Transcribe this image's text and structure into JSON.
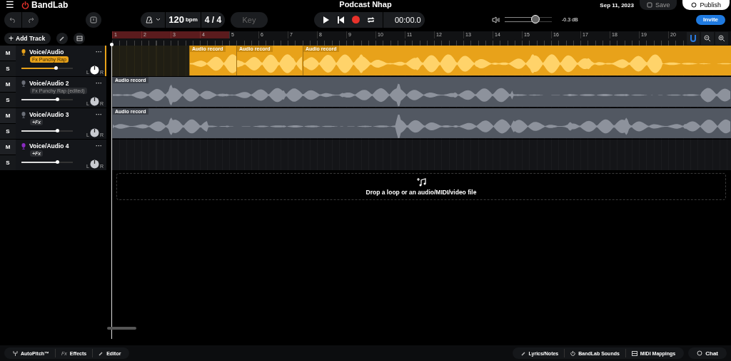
{
  "header": {
    "menu_icon": "☰",
    "logo": "BandLab",
    "title": "Podcast Nhap",
    "last_saved": "Sep 11, 2023",
    "save": {
      "label": "Save",
      "disabled": true
    },
    "publish": "Publish"
  },
  "toolbar": {
    "tempo": "120",
    "tempo_unit": "bpm",
    "time_signature": "4 / 4",
    "key": "Key",
    "time": "00:00.0",
    "master": {
      "level": 0.65,
      "reading": "-0.3 dB"
    },
    "invite": "Invite"
  },
  "add_track": {
    "icon": "+",
    "label": "Add Track"
  },
  "ruler": {
    "bars": [
      {
        "label": "1",
        "in_loop": true
      },
      {
        "label": "2",
        "in_loop": true
      },
      {
        "label": "3",
        "in_loop": true
      },
      {
        "label": "4",
        "in_loop": true
      },
      {
        "label": "5",
        "in_loop": false
      },
      {
        "label": "6",
        "in_loop": false
      },
      {
        "label": "7",
        "in_loop": false
      },
      {
        "label": "8",
        "in_loop": false
      },
      {
        "label": "9",
        "in_loop": false
      },
      {
        "label": "10",
        "in_loop": false
      },
      {
        "label": "11",
        "in_loop": false
      },
      {
        "label": "12",
        "in_loop": false
      },
      {
        "label": "13",
        "in_loop": false
      },
      {
        "label": "14",
        "in_loop": false
      },
      {
        "label": "15",
        "in_loop": false
      },
      {
        "label": "16",
        "in_loop": false
      },
      {
        "label": "17",
        "in_loop": false
      },
      {
        "label": "18",
        "in_loop": false
      },
      {
        "label": "19",
        "in_loop": false
      },
      {
        "label": "20",
        "in_loop": false
      }
    ]
  },
  "tracks": [
    {
      "name": "Voice/Audio",
      "menu": "···",
      "mute": "M",
      "solo": "S",
      "fx_preset": "Fx Punchy Rap",
      "selected": true,
      "color": "#e8a21a",
      "level": 0.68,
      "pan_left": "L",
      "pan_right": "R",
      "clips": [
        "Audio record",
        "Audio record",
        "Audio record"
      ]
    },
    {
      "name": "Voice/Audio 2",
      "menu": "···",
      "mute": "M",
      "solo": "S",
      "fx_preset": "Fx Punchy Rap (edited)",
      "selected": false,
      "color": "#6b6f78",
      "level": 0.7,
      "pan_left": "L",
      "pan_right": "R",
      "clips": [
        "Audio record"
      ]
    },
    {
      "name": "Voice/Audio 3",
      "menu": "···",
      "mute": "M",
      "solo": "S",
      "fx_add": "+Fx",
      "selected": false,
      "color": "#6b6f78",
      "level": 0.7,
      "pan_left": "L",
      "pan_right": "R",
      "clips": [
        "Audio record"
      ]
    },
    {
      "name": "Voice/Audio 4",
      "menu": "···",
      "mute": "M",
      "solo": "S",
      "fx_add": "+Fx",
      "selected": false,
      "color": "#8a2bc2",
      "level": 0.7,
      "pan_left": "L",
      "pan_right": "R"
    }
  ],
  "drop_zone": "Drop a loop or an audio/MIDI/video file",
  "bottom_left": [
    {
      "label": "AutoPitch™"
    },
    {
      "label": "Effects",
      "icon_text": "Fx"
    },
    {
      "label": "Editor"
    }
  ],
  "bottom_right": [
    {
      "label": "Lyrics/Notes"
    },
    {
      "label": "BandLab Sounds"
    },
    {
      "label": "MIDI Mappings"
    }
  ],
  "chat": "Chat"
}
